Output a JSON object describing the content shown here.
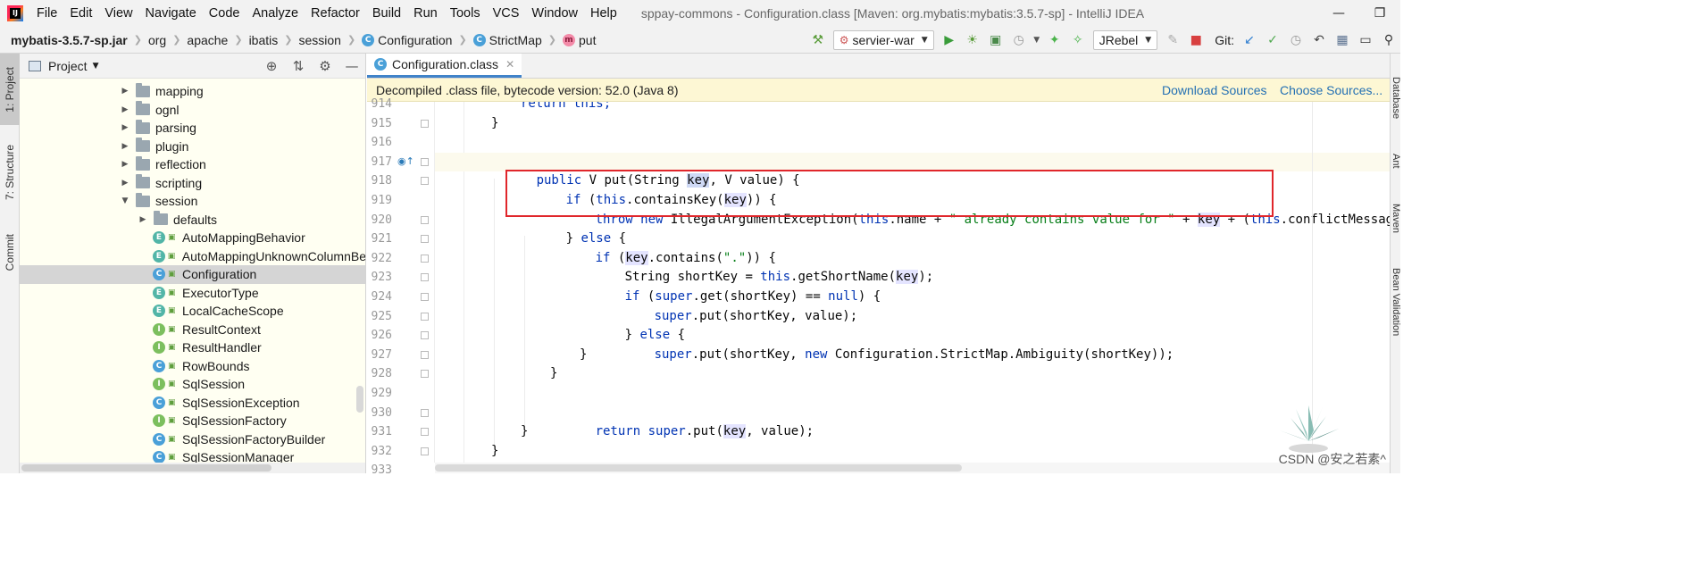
{
  "app": {
    "logo_text": "IJ",
    "window_title": "sppay-commons - Configuration.class [Maven: org.mybatis:mybatis:3.5.7-sp] - IntelliJ IDEA",
    "menu": [
      "File",
      "Edit",
      "View",
      "Navigate",
      "Code",
      "Analyze",
      "Refactor",
      "Build",
      "Run",
      "Tools",
      "VCS",
      "Window",
      "Help"
    ]
  },
  "breadcrumb": {
    "items": [
      "mybatis-3.5.7-sp.jar",
      "org",
      "apache",
      "ibatis",
      "session",
      "Configuration",
      "StrictMap",
      "put"
    ],
    "icons": [
      "",
      "",
      "",
      "",
      "",
      "C",
      "C",
      "m"
    ]
  },
  "toolbar": {
    "run_config": "servier-war",
    "jrebel": "JRebel",
    "git_label": "Git:"
  },
  "left_strip": {
    "project": "1: Project",
    "structure": "7: Structure",
    "commit": "Commit"
  },
  "right_strip": {
    "database": "Database",
    "ant": "Ant",
    "maven": "Maven",
    "bean_validation": "Bean Validation"
  },
  "project_panel": {
    "title": "Project",
    "tree": [
      {
        "label": "mapping",
        "type": "folder",
        "depth": 0,
        "arrow": "right"
      },
      {
        "label": "ognl",
        "type": "folder",
        "depth": 0,
        "arrow": "right"
      },
      {
        "label": "parsing",
        "type": "folder",
        "depth": 0,
        "arrow": "right"
      },
      {
        "label": "plugin",
        "type": "folder",
        "depth": 0,
        "arrow": "right"
      },
      {
        "label": "reflection",
        "type": "folder",
        "depth": 0,
        "arrow": "right"
      },
      {
        "label": "scripting",
        "type": "folder",
        "depth": 0,
        "arrow": "right"
      },
      {
        "label": "session",
        "type": "folder",
        "depth": 0,
        "arrow": "down"
      },
      {
        "label": "defaults",
        "type": "folder",
        "depth": 1,
        "arrow": "right"
      },
      {
        "label": "AutoMappingBehavior",
        "type": "E",
        "depth": 1
      },
      {
        "label": "AutoMappingUnknownColumnBe",
        "type": "E",
        "depth": 1
      },
      {
        "label": "Configuration",
        "type": "C",
        "depth": 1,
        "selected": true
      },
      {
        "label": "ExecutorType",
        "type": "E",
        "depth": 1
      },
      {
        "label": "LocalCacheScope",
        "type": "E",
        "depth": 1
      },
      {
        "label": "ResultContext",
        "type": "I",
        "depth": 1
      },
      {
        "label": "ResultHandler",
        "type": "I",
        "depth": 1
      },
      {
        "label": "RowBounds",
        "type": "C",
        "depth": 1
      },
      {
        "label": "SqlSession",
        "type": "I",
        "depth": 1
      },
      {
        "label": "SqlSessionException",
        "type": "C",
        "depth": 1
      },
      {
        "label": "SqlSessionFactory",
        "type": "I",
        "depth": 1
      },
      {
        "label": "SqlSessionFactoryBuilder",
        "type": "C",
        "depth": 1
      },
      {
        "label": "SqlSessionManager",
        "type": "C",
        "depth": 1
      }
    ]
  },
  "editor": {
    "tab_label": "Configuration.class",
    "banner_text": "Decompiled .class file, bytecode version: 52.0 (Java 8)",
    "download_sources": "Download Sources",
    "choose_sources": "Choose Sources...",
    "line_numbers": [
      "914",
      "915",
      "916",
      "917",
      "918",
      "919",
      "920",
      "921",
      "922",
      "923",
      "924",
      "925",
      "926",
      "927",
      "928",
      "929",
      "930",
      "931",
      "932",
      "933"
    ],
    "code": {
      "l914": "return this;",
      "l915": "}",
      "l917_kw": "public",
      "l917_a": " V put(String ",
      "l917_key": "key",
      "l917_b": ", V value) {",
      "l918_kw": "if",
      "l918_a": " (",
      "l918_this": "this",
      "l918_b": ".containsKey(",
      "l918_key": "key",
      "l918_c": ")) {",
      "l919_kw": "throw new",
      "l919_a": " IllegalArgumentException(",
      "l919_this": "this",
      "l919_b": ".name + ",
      "l919_str": "\" already contains value for \"",
      "l919_c": " + ",
      "l919_key": "key",
      "l919_d": " + (",
      "l919_this2": "this",
      "l919_e": ".conflictMessageProducer",
      "l920_a": "} ",
      "l920_kw": "else",
      "l920_b": " {",
      "l921_kw": "if",
      "l921_a": " (",
      "l921_key": "key",
      "l921_b": ".contains(",
      "l921_str": "\".\"",
      "l921_c": ")) {",
      "l922_a": "String shortKey = ",
      "l922_this": "this",
      "l922_b": ".getShortName(",
      "l922_key": "key",
      "l922_c": ");",
      "l923_kw": "if",
      "l923_a": " (",
      "l923_super": "super",
      "l923_b": ".get(shortKey) == ",
      "l923_null": "null",
      "l923_c": ") {",
      "l924_super": "super",
      "l924_a": ".put(shortKey, value);",
      "l925_a": "} ",
      "l925_kw": "else",
      "l925_b": " {",
      "l926_super": "super",
      "l926_a": ".put(shortKey, ",
      "l926_kw": "new",
      "l926_b": " Configuration.StrictMap.Ambiguity(shortKey));",
      "l927": "}",
      "l928": "}",
      "l930_kw": "return",
      "l930_a": " ",
      "l930_super": "super",
      "l930_b": ".put(",
      "l930_key": "key",
      "l930_c": ", value);",
      "l931": "}",
      "l932": "}"
    }
  },
  "watermark": "CSDN @安之若素^"
}
